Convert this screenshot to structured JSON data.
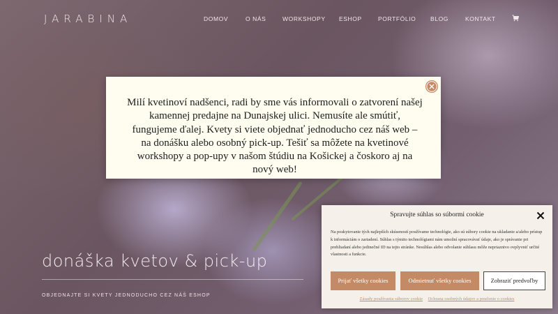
{
  "brand": {
    "logo_text": "JARABINA"
  },
  "nav": {
    "items": [
      {
        "label": "DOMOV"
      },
      {
        "label": "O NÁS"
      },
      {
        "label": "WORKSHOPY"
      },
      {
        "label": "ESHOP"
      },
      {
        "label": "PORTFÓLIO"
      },
      {
        "label": "BLOG"
      },
      {
        "label": "KONTAKT"
      }
    ],
    "cart_icon": "cart-icon"
  },
  "hero": {
    "title": "donáška kvetov & pick-up",
    "subtitle": "OBJEDNAJTE SI KVETY JEDNODUCHO CEZ NÁŠ ESHOP"
  },
  "popup": {
    "message": "Milí kvetinoví nadšenci, radi by sme vás informovali o zatvorení našej kamennej predajne na Dunajskej ulici. Nemusíte ale smútiť, fungujeme ďalej. Kvety si viete objednať jednoducho cez náš web – na donášku alebo osobný pick-up. Tešiť sa môžete na kvetinové workshopy a pop-upy v našom štúdiu na Košickej a čoskoro aj na nový web!",
    "close_icon": "close-icon",
    "accent_color": "#c88a66"
  },
  "cookie_consent": {
    "title": "Spravujte súhlas so súbormi cookie",
    "body": "Na poskytovanie tých najlepších skúseností používame technológie, ako sú súbory cookie na ukladanie a/alebo prístup k informáciám o zariadení. Súhlas s týmito technológiami nám umožní spracovávať údaje, ako je správanie pri prehliadaní alebo jedinečné ID na tejto stránke. Nesúhlas alebo odvolanie súhlasu môže nepriaznivo ovplyvniť určité vlastnosti a funkcie.",
    "accept_label": "Prijať všetky cookies",
    "deny_label": "Odmietnuť všetky cookies",
    "prefs_label": "Zobraziť predvoľby",
    "link_policy": "Zásady používania súborov cookie",
    "link_privacy": "Ochrana osobných údajov a poučenie o cookies",
    "accent_color": "#c48a66"
  }
}
